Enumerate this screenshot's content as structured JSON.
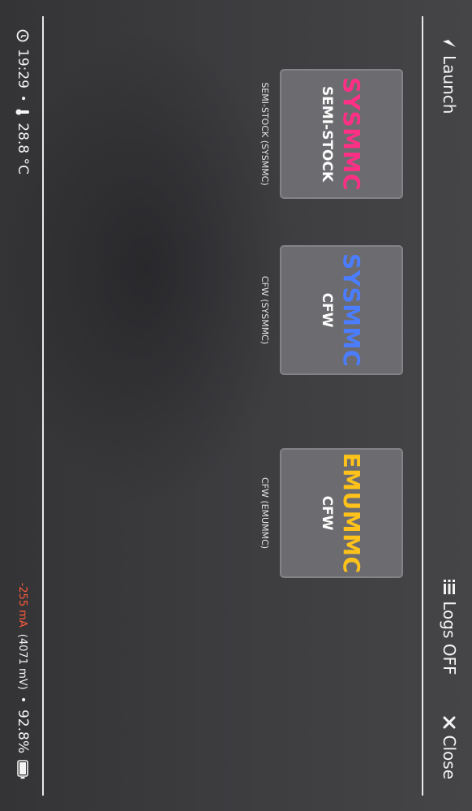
{
  "header": {
    "launch_label": "Launch",
    "logs_label": "Logs OFF",
    "close_label": "Close"
  },
  "tiles": [
    {
      "title": "SYSMMC",
      "subtitle": "SEMI-STOCK",
      "caption": "SEMI-STOCK (SYSMMC)",
      "title_color": "#ff2f86"
    },
    {
      "title": "SYSMMC",
      "subtitle": "CFW",
      "caption": "CFW (SYSMMC)",
      "title_color": "#4a7dff"
    },
    {
      "title": "EMUMMC",
      "subtitle": "CFW",
      "caption": "CFW (EMUMMC)",
      "title_color": "#ffc21a"
    }
  ],
  "footer": {
    "time": "19:29",
    "temperature": "28.8 °C",
    "current": "-255 mA",
    "voltage": "(4071 mV)",
    "battery": "92.8%",
    "separator": "•"
  },
  "colors": {
    "accent_current": "#ff5a3c",
    "tile_bg": "#6c6c70"
  }
}
